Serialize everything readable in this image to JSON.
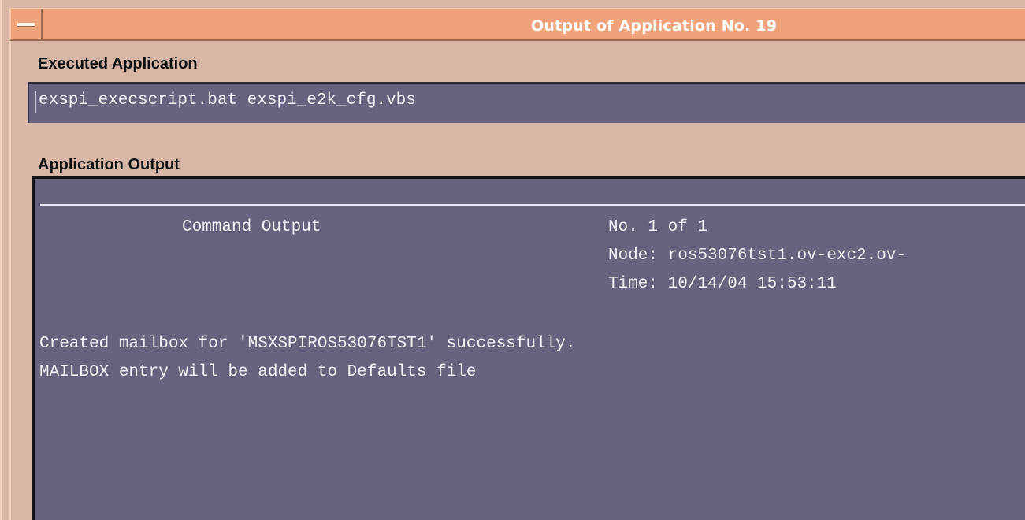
{
  "window": {
    "title": "Output of Application No. 19"
  },
  "executed_application": {
    "label": "Executed Application",
    "value": "exspi_execscript.bat exspi_e2k_cfg.vbs"
  },
  "application_output": {
    "label": "Application Output",
    "header_left": "Command Output",
    "header_right": {
      "counter": "No. 1 of 1",
      "node": "Node: ros53076tst1.ov-exc2.ov-",
      "time": "Time: 10/14/04 15:53:11"
    },
    "lines": [
      "Created mailbox for 'MSXSPIROS53076TST1' successfully.",
      "MAILBOX entry will be added to Defaults file"
    ]
  },
  "colors": {
    "titlebar": "#f0a27a",
    "window_bg": "#d7b6a6",
    "field_bg": "#67637f",
    "text_light": "#f0f0f4"
  },
  "icons": {
    "window_menu": "window-menu-icon"
  }
}
